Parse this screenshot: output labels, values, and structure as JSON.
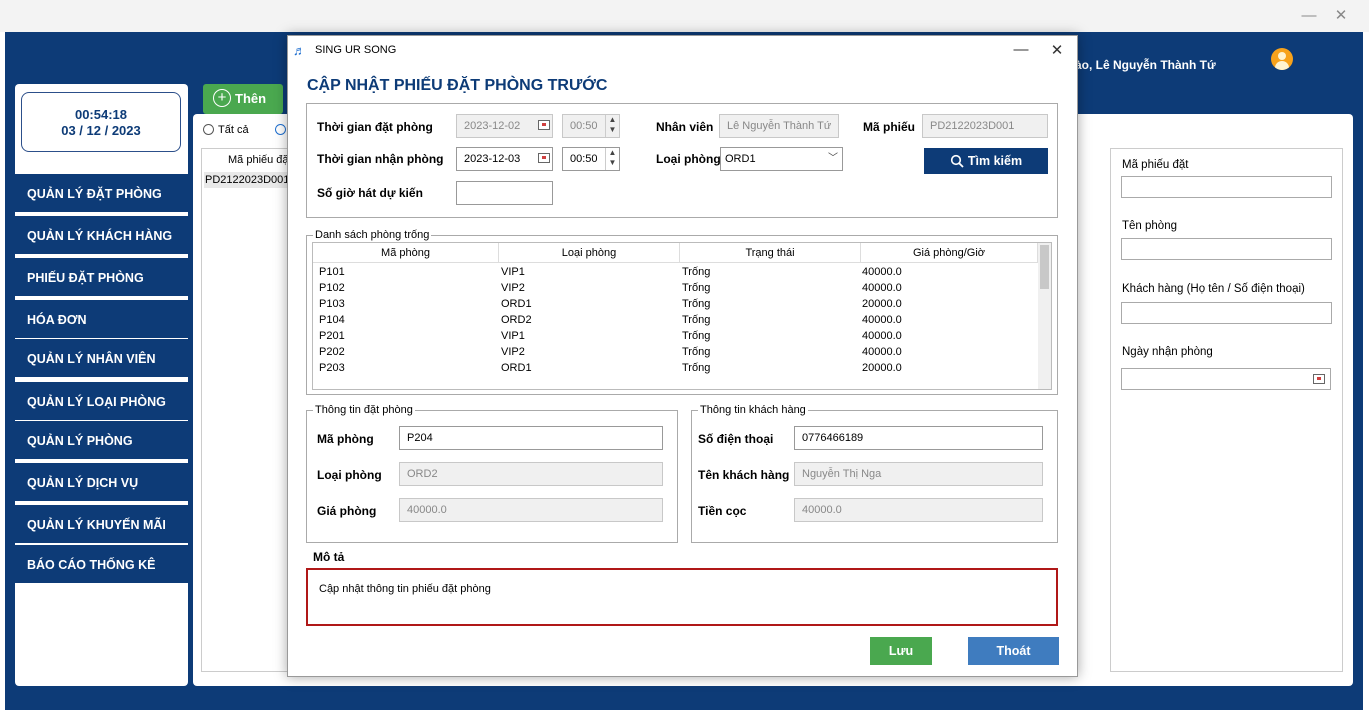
{
  "window": {
    "minimize": "—",
    "close": "✕"
  },
  "header": {
    "greeting": "ào, Lê Nguyễn Thành Tứ"
  },
  "clock": {
    "time": "00:54:18",
    "date": "03 / 12 / 2023"
  },
  "sidebar": {
    "items": [
      {
        "label": "QUẢN LÝ ĐẶT PHÒNG"
      },
      {
        "label": "QUẢN LÝ KHÁCH HÀNG"
      },
      {
        "label": "PHIẾU ĐẶT PHÒNG"
      },
      {
        "label": "HÓA ĐƠN"
      },
      {
        "label": "QUẢN LÝ NHÂN VIÊN"
      },
      {
        "label": "QUẢN LÝ LOẠI PHÒNG"
      },
      {
        "label": "QUẢN LÝ PHÒNG"
      },
      {
        "label": "QUẢN LÝ DỊCH VỤ"
      },
      {
        "label": "QUẢN LÝ KHUYẾN MÃI"
      },
      {
        "label": "BÁO CÁO THỐNG KÊ"
      }
    ]
  },
  "main": {
    "add_label": "Thên",
    "radio_all": "Tất cả",
    "list_header": "Mã phiếu đặ",
    "list_row": "PD2122023D001"
  },
  "filter": {
    "ma_phieu_label": "Mã phiếu đặt",
    "ten_phong_label": "Tên phòng",
    "khach_hang_label": "Khách hàng (Họ tên / Số điện thoại)",
    "ngay_nhan_label": "Ngày nhận phòng"
  },
  "dialog": {
    "app_name": "SING UR SONG",
    "minimize": "—",
    "close": "✕",
    "heading": "CẬP NHẬT PHIẾU ĐẶT PHÒNG TRƯỚC",
    "thoi_gian_dat_label": "Thời gian đặt phòng",
    "thoi_gian_dat_date": "2023-12-02",
    "thoi_gian_dat_time": "00:50",
    "thoi_gian_nhan_label": "Thời gian nhận phòng",
    "thoi_gian_nhan_date": "2023-12-03",
    "thoi_gian_nhan_time": "00:50",
    "so_gio_label": "Số giờ hát dự kiến",
    "so_gio_value": "",
    "nhan_vien_label": "Nhân viên",
    "nhan_vien_value": "Lê Nguyễn Thành Tứ",
    "ma_phieu_label": "Mã phiếu",
    "ma_phieu_value": "PD2122023D001",
    "loai_phong_label": "Loại phòng",
    "loai_phong_value": "ORD1",
    "search_label": "Tìm kiếm",
    "table_legend": "Danh sách phòng trống",
    "table_headers": [
      "Mã phòng",
      "Loại phòng",
      "Trạng thái",
      "Giá phòng/Giờ"
    ],
    "table_rows": [
      [
        "P101",
        "VIP1",
        "Trống",
        "40000.0"
      ],
      [
        "P102",
        "VIP2",
        "Trống",
        "40000.0"
      ],
      [
        "P103",
        "ORD1",
        "Trống",
        "20000.0"
      ],
      [
        "P104",
        "ORD2",
        "Trống",
        "40000.0"
      ],
      [
        "P201",
        "VIP1",
        "Trống",
        "40000.0"
      ],
      [
        "P202",
        "VIP2",
        "Trống",
        "40000.0"
      ],
      [
        "P203",
        "ORD1",
        "Trống",
        "20000.0"
      ]
    ],
    "booking_legend": "Thông tin đặt phòng",
    "ma_phong_label": "Mã phòng",
    "ma_phong_value": "P204",
    "loai_phong2_label": "Loại phòng",
    "loai_phong2_value": "ORD2",
    "gia_phong_label": "Giá phòng",
    "gia_phong_value": "40000.0",
    "customer_legend": "Thông tin khách hàng",
    "sdt_label": "Số điện thoại",
    "sdt_value": "0776466189",
    "ten_kh_label": "Tên khách hàng",
    "ten_kh_value": "Nguyễn Thị Nga",
    "tien_coc_label": "Tiền cọc",
    "tien_coc_value": "40000.0",
    "mo_ta_label": "Mô tả",
    "mo_ta_value": "Cập nhật thông tin phiếu đặt phòng",
    "save_label": "Lưu",
    "exit_label": "Thoát"
  },
  "colors": {
    "navy": "#0d3b77",
    "green": "#4aa84f",
    "blue_btn": "#3f7cbf",
    "red_border": "#b01818"
  }
}
